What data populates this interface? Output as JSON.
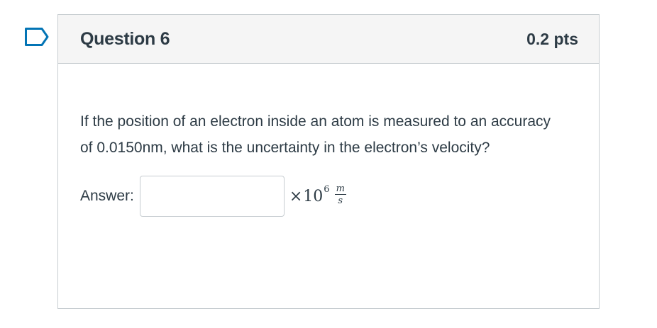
{
  "question": {
    "title": "Question 6",
    "points": "0.2 pts",
    "text": "If the position of an electron inside an atom is measured to an accuracy of 0.0150nm, what is the uncertainty in the electron’s velocity?",
    "answer_label": "Answer:",
    "answer_value": "",
    "unit": {
      "times": "×",
      "base": "10",
      "exponent": "6",
      "numerator": "m",
      "denominator": "s"
    }
  },
  "icons": {
    "flag": "flag-outline-icon"
  },
  "colors": {
    "text": "#2d3b45",
    "header_bg": "#f5f5f5",
    "border": "#c7cdd1",
    "flag_outline": "#0374b5"
  }
}
